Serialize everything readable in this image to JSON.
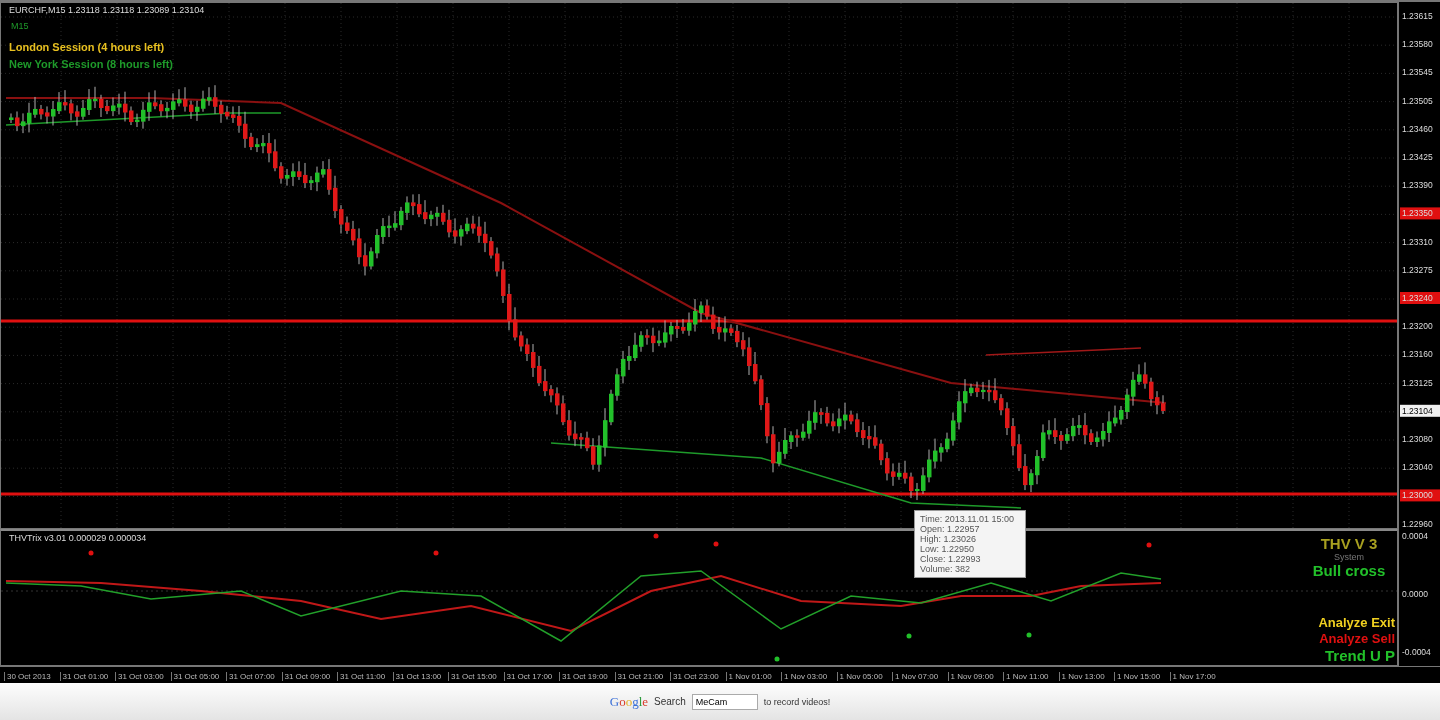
{
  "chart_header": "EURCHF,M15  1.23118 1.23118 1.23089 1.23104",
  "timeframe_label": "M15",
  "sessions": [
    {
      "label": "London Session (4 hours left)",
      "color": "#e8c020"
    },
    {
      "label": "New York Session (8 hours left)",
      "color": "#1e9a2a"
    }
  ],
  "price_axis": [
    {
      "text": "1.23615",
      "kind": "tick"
    },
    {
      "text": "1.23580",
      "kind": "tick"
    },
    {
      "text": "1.23545",
      "kind": "tick"
    },
    {
      "text": "1.23505",
      "kind": "tick"
    },
    {
      "text": "1.23460",
      "kind": "tick"
    },
    {
      "text": "1.23425",
      "kind": "tick"
    },
    {
      "text": "1.23390",
      "kind": "tick"
    },
    {
      "text": "1.23350",
      "kind": "marker"
    },
    {
      "text": "1.23310",
      "kind": "tick"
    },
    {
      "text": "1.23275",
      "kind": "tick"
    },
    {
      "text": "1.23240",
      "kind": "marker"
    },
    {
      "text": "1.23200",
      "kind": "tick"
    },
    {
      "text": "1.23160",
      "kind": "tick"
    },
    {
      "text": "1.23125",
      "kind": "tick"
    },
    {
      "text": "1.23104",
      "kind": "current"
    },
    {
      "text": "1.23080",
      "kind": "tick"
    },
    {
      "text": "1.23040",
      "kind": "tick"
    },
    {
      "text": "1.23000",
      "kind": "marker"
    },
    {
      "text": "1.22960",
      "kind": "tick"
    }
  ],
  "tooltip": [
    "Time: 2013.11.01 15:00",
    "Open: 1.22957",
    "High: 1.23026",
    "Low: 1.22950",
    "Close: 1.22993",
    "Volume: 382"
  ],
  "indicator": {
    "header": "THVTrix v3.01 0.000029 0.000034",
    "title": "THV V 3",
    "subtitle": "System",
    "signal": "Bull cross",
    "axis_labels": [
      "0.0004",
      "0.0000",
      "-0.0004"
    ]
  },
  "signals": [
    {
      "text": "Analyze Exit",
      "color": "#f0d020"
    },
    {
      "text": "Analyze Sell",
      "color": "#e01010"
    },
    {
      "text": "Trend U P",
      "color": "#22c02a"
    }
  ],
  "time_axis": [
    "30 Oct 2013",
    "31 Oct 01:00",
    "31 Oct 03:00",
    "31 Oct 05:00",
    "31 Oct 07:00",
    "31 Oct 09:00",
    "31 Oct 11:00",
    "31 Oct 13:00",
    "31 Oct 15:00",
    "31 Oct 17:00",
    "31 Oct 19:00",
    "31 Oct 21:00",
    "31 Oct 23:00",
    "1 Nov 01:00",
    "1 Nov 03:00",
    "1 Nov 05:00",
    "1 Nov 07:00",
    "1 Nov 09:00",
    "1 Nov 11:00",
    "1 Nov 13:00",
    "1 Nov 15:00",
    "1 Nov 17:00"
  ],
  "footer": {
    "logo": "Google",
    "search_label": "Search",
    "search_value": "MeCam",
    "note": "to record videos!"
  }
}
